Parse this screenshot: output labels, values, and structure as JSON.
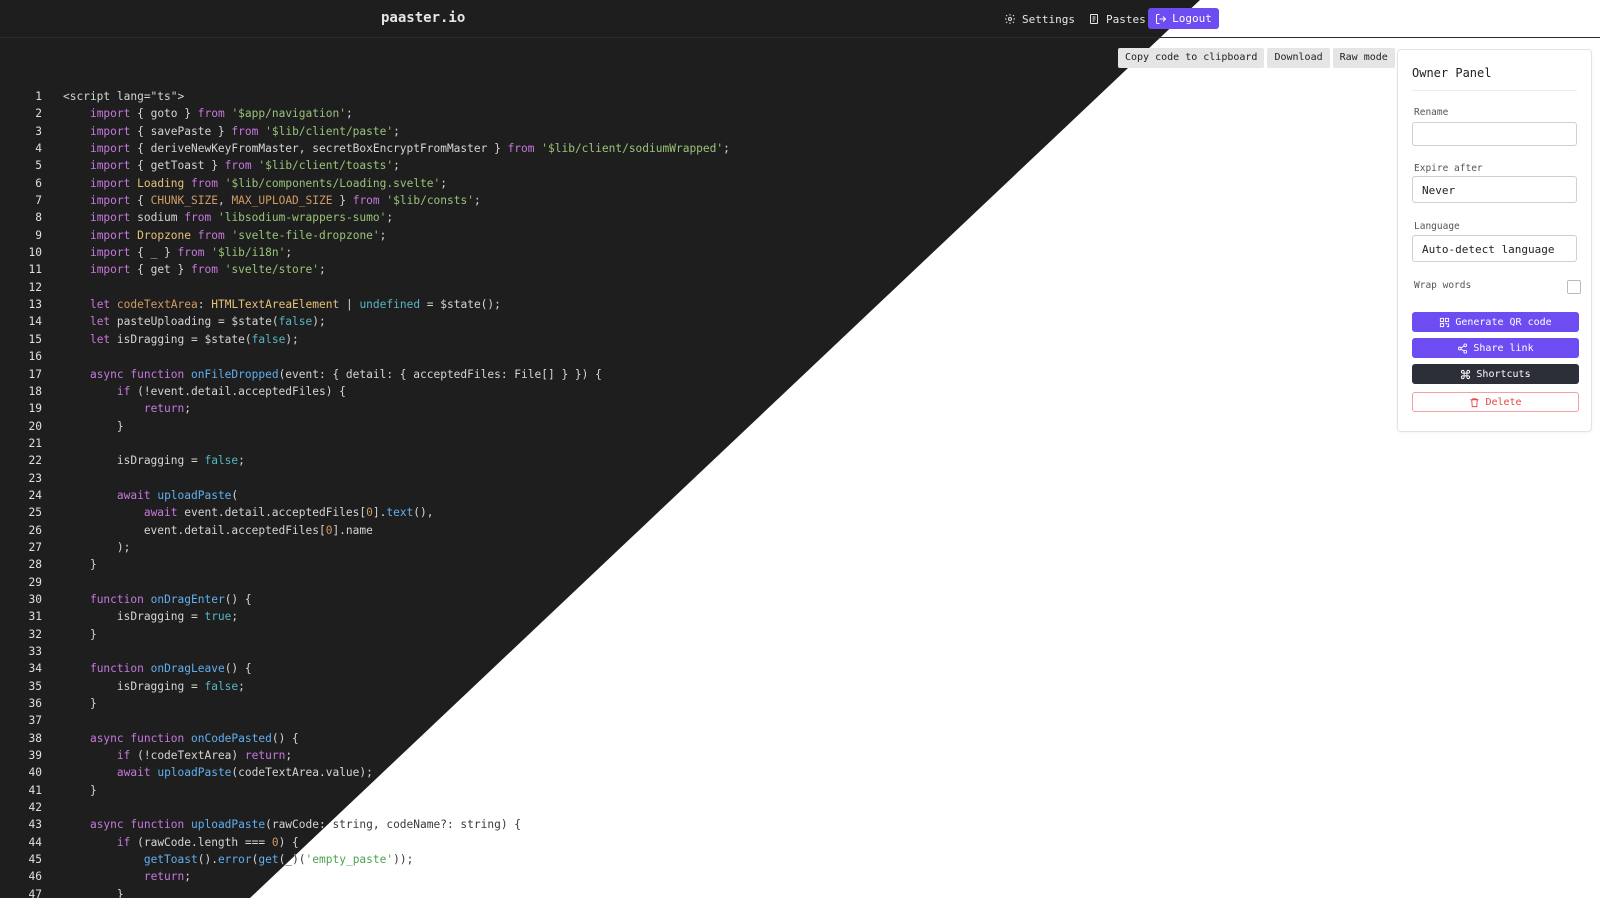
{
  "header": {
    "brand": "paaster.io",
    "settings_label": "Settings",
    "pastes_label": "Pastes",
    "logout_label": "Logout"
  },
  "toolbar": {
    "copy_label": "Copy code to clipboard",
    "download_label": "Download",
    "raw_label": "Raw mode"
  },
  "panel": {
    "title": "Owner Panel",
    "rename_label": "Rename",
    "rename_value": "",
    "expire_label": "Expire after",
    "expire_value": "Never",
    "language_label": "Language",
    "language_value": "Auto-detect language",
    "wrap_label": "Wrap words",
    "wrap_checked": false,
    "qr_label": "Generate QR code",
    "share_label": "Share link",
    "shortcuts_label": "Shortcuts",
    "delete_label": "Delete"
  },
  "colors": {
    "accent": "#6d4df2",
    "dark_bg": "#1e1e1e",
    "delete": "#e54545"
  },
  "code_lines": [
    [
      [
        "t",
        "<script lang=\"ts\">"
      ]
    ],
    [
      [
        "t",
        "    "
      ],
      [
        "k",
        "import"
      ],
      [
        "t",
        " { goto } "
      ],
      [
        "k",
        "from"
      ],
      [
        "t",
        " "
      ],
      [
        "s",
        "'$app/navigation'"
      ],
      [
        "t",
        ";"
      ]
    ],
    [
      [
        "t",
        "    "
      ],
      [
        "k",
        "import"
      ],
      [
        "t",
        " { savePaste } "
      ],
      [
        "k",
        "from"
      ],
      [
        "t",
        " "
      ],
      [
        "s",
        "'$lib/client/paste'"
      ],
      [
        "t",
        ";"
      ]
    ],
    [
      [
        "t",
        "    "
      ],
      [
        "k",
        "import"
      ],
      [
        "t",
        " { deriveNewKeyFromMaster, secretBoxEncryptFromMaster } "
      ],
      [
        "k",
        "from"
      ],
      [
        "t",
        " "
      ],
      [
        "s",
        "'$lib/client/sodiumWrapped'"
      ],
      [
        "t",
        ";"
      ]
    ],
    [
      [
        "t",
        "    "
      ],
      [
        "k",
        "import"
      ],
      [
        "t",
        " { getToast } "
      ],
      [
        "k",
        "from"
      ],
      [
        "t",
        " "
      ],
      [
        "s",
        "'$lib/client/toasts'"
      ],
      [
        "t",
        ";"
      ]
    ],
    [
      [
        "t",
        "    "
      ],
      [
        "k",
        "import"
      ],
      [
        "t",
        " "
      ],
      [
        "y",
        "Loading"
      ],
      [
        "t",
        " "
      ],
      [
        "k",
        "from"
      ],
      [
        "t",
        " "
      ],
      [
        "s",
        "'$lib/components/Loading.svelte'"
      ],
      [
        "t",
        ";"
      ]
    ],
    [
      [
        "t",
        "    "
      ],
      [
        "k",
        "import"
      ],
      [
        "t",
        " { "
      ],
      [
        "c",
        "CHUNK_SIZE"
      ],
      [
        "t",
        ", "
      ],
      [
        "c",
        "MAX_UPLOAD_SIZE"
      ],
      [
        "t",
        " } "
      ],
      [
        "k",
        "from"
      ],
      [
        "t",
        " "
      ],
      [
        "s",
        "'$lib/consts'"
      ],
      [
        "t",
        ";"
      ]
    ],
    [
      [
        "t",
        "    "
      ],
      [
        "k",
        "import"
      ],
      [
        "t",
        " sodium "
      ],
      [
        "k",
        "from"
      ],
      [
        "t",
        " "
      ],
      [
        "s",
        "'libsodium-wrappers-sumo'"
      ],
      [
        "t",
        ";"
      ]
    ],
    [
      [
        "t",
        "    "
      ],
      [
        "k",
        "import"
      ],
      [
        "t",
        " "
      ],
      [
        "y",
        "Dropzone"
      ],
      [
        "t",
        " "
      ],
      [
        "k",
        "from"
      ],
      [
        "t",
        " "
      ],
      [
        "s",
        "'svelte-file-dropzone'"
      ],
      [
        "t",
        ";"
      ]
    ],
    [
      [
        "t",
        "    "
      ],
      [
        "k",
        "import"
      ],
      [
        "t",
        " { _ } "
      ],
      [
        "k",
        "from"
      ],
      [
        "t",
        " "
      ],
      [
        "s",
        "'$lib/i18n'"
      ],
      [
        "t",
        ";"
      ]
    ],
    [
      [
        "t",
        "    "
      ],
      [
        "k",
        "import"
      ],
      [
        "t",
        " { get } "
      ],
      [
        "k",
        "from"
      ],
      [
        "t",
        " "
      ],
      [
        "s",
        "'svelte/store'"
      ],
      [
        "t",
        ";"
      ]
    ],
    [
      [
        "t",
        ""
      ]
    ],
    [
      [
        "t",
        "    "
      ],
      [
        "k",
        "let"
      ],
      [
        "t",
        " "
      ],
      [
        "c",
        "codeTextArea"
      ],
      [
        "t",
        ": "
      ],
      [
        "y",
        "HTMLTextAreaElement"
      ],
      [
        "t",
        " | "
      ],
      [
        "l",
        "undefined"
      ],
      [
        "t",
        " = $state();"
      ]
    ],
    [
      [
        "t",
        "    "
      ],
      [
        "k",
        "let"
      ],
      [
        "t",
        " pasteUploading = $state("
      ],
      [
        "l",
        "false"
      ],
      [
        "t",
        ");"
      ]
    ],
    [
      [
        "t",
        "    "
      ],
      [
        "k",
        "let"
      ],
      [
        "t",
        " isDragging = $state("
      ],
      [
        "l",
        "false"
      ],
      [
        "t",
        ");"
      ]
    ],
    [
      [
        "t",
        ""
      ]
    ],
    [
      [
        "t",
        "    "
      ],
      [
        "k",
        "async function"
      ],
      [
        "t",
        " "
      ],
      [
        "f",
        "onFileDropped"
      ],
      [
        "t",
        "(event: { detail: { acceptedFiles: File[] } }) {"
      ]
    ],
    [
      [
        "t",
        "        "
      ],
      [
        "k",
        "if"
      ],
      [
        "t",
        " (!event.detail.acceptedFiles) {"
      ]
    ],
    [
      [
        "t",
        "            "
      ],
      [
        "k",
        "return"
      ],
      [
        "t",
        ";"
      ]
    ],
    [
      [
        "t",
        "        }"
      ]
    ],
    [
      [
        "t",
        ""
      ]
    ],
    [
      [
        "t",
        "        isDragging = "
      ],
      [
        "l",
        "false"
      ],
      [
        "t",
        ";"
      ]
    ],
    [
      [
        "t",
        ""
      ]
    ],
    [
      [
        "t",
        "        "
      ],
      [
        "k",
        "await"
      ],
      [
        "t",
        " "
      ],
      [
        "f",
        "uploadPaste"
      ],
      [
        "t",
        "("
      ]
    ],
    [
      [
        "t",
        "            "
      ],
      [
        "k",
        "await"
      ],
      [
        "t",
        " event.detail.acceptedFiles["
      ],
      [
        "c",
        "0"
      ],
      [
        "t",
        "]."
      ],
      [
        "f",
        "text"
      ],
      [
        "t",
        "(),"
      ]
    ],
    [
      [
        "t",
        "            event.detail.acceptedFiles["
      ],
      [
        "c",
        "0"
      ],
      [
        "t",
        "].name"
      ]
    ],
    [
      [
        "t",
        "        );"
      ]
    ],
    [
      [
        "t",
        "    }"
      ]
    ],
    [
      [
        "t",
        ""
      ]
    ],
    [
      [
        "t",
        "    "
      ],
      [
        "k",
        "function"
      ],
      [
        "t",
        " "
      ],
      [
        "f",
        "onDragEnter"
      ],
      [
        "t",
        "() {"
      ]
    ],
    [
      [
        "t",
        "        isDragging = "
      ],
      [
        "l",
        "true"
      ],
      [
        "t",
        ";"
      ]
    ],
    [
      [
        "t",
        "    }"
      ]
    ],
    [
      [
        "t",
        ""
      ]
    ],
    [
      [
        "t",
        "    "
      ],
      [
        "k",
        "function"
      ],
      [
        "t",
        " "
      ],
      [
        "f",
        "onDragLeave"
      ],
      [
        "t",
        "() {"
      ]
    ],
    [
      [
        "t",
        "        isDragging = "
      ],
      [
        "l",
        "false"
      ],
      [
        "t",
        ";"
      ]
    ],
    [
      [
        "t",
        "    }"
      ]
    ],
    [
      [
        "t",
        ""
      ]
    ],
    [
      [
        "t",
        "    "
      ],
      [
        "k",
        "async function"
      ],
      [
        "t",
        " "
      ],
      [
        "f",
        "onCodePasted"
      ],
      [
        "t",
        "() {"
      ]
    ],
    [
      [
        "t",
        "        "
      ],
      [
        "k",
        "if"
      ],
      [
        "t",
        " (!codeTextArea) "
      ],
      [
        "k",
        "return"
      ],
      [
        "t",
        ";"
      ]
    ],
    [
      [
        "t",
        "        "
      ],
      [
        "k",
        "await"
      ],
      [
        "t",
        " "
      ],
      [
        "f",
        "uploadPaste"
      ],
      [
        "t",
        "(codeTextArea.value);"
      ]
    ],
    [
      [
        "t",
        "    }"
      ]
    ],
    [
      [
        "t",
        ""
      ]
    ],
    [
      [
        "t",
        "    "
      ],
      [
        "k",
        "async function"
      ],
      [
        "t",
        " "
      ],
      [
        "f",
        "uploadPaste"
      ],
      [
        "t",
        "(rawCode: string, codeName?: string) {"
      ]
    ],
    [
      [
        "t",
        "        "
      ],
      [
        "k",
        "if"
      ],
      [
        "t",
        " (rawCode.length === "
      ],
      [
        "c",
        "0"
      ],
      [
        "t",
        ") {"
      ]
    ],
    [
      [
        "t",
        "            "
      ],
      [
        "f",
        "getToast"
      ],
      [
        "t",
        "()."
      ],
      [
        "f",
        "error"
      ],
      [
        "t",
        "("
      ],
      [
        "f",
        "get"
      ],
      [
        "t",
        "(_)("
      ],
      [
        "s",
        "'empty_paste'"
      ],
      [
        "t",
        "));"
      ]
    ],
    [
      [
        "t",
        "            "
      ],
      [
        "k",
        "return"
      ],
      [
        "t",
        ";"
      ]
    ],
    [
      [
        "t",
        "        }"
      ]
    ]
  ]
}
